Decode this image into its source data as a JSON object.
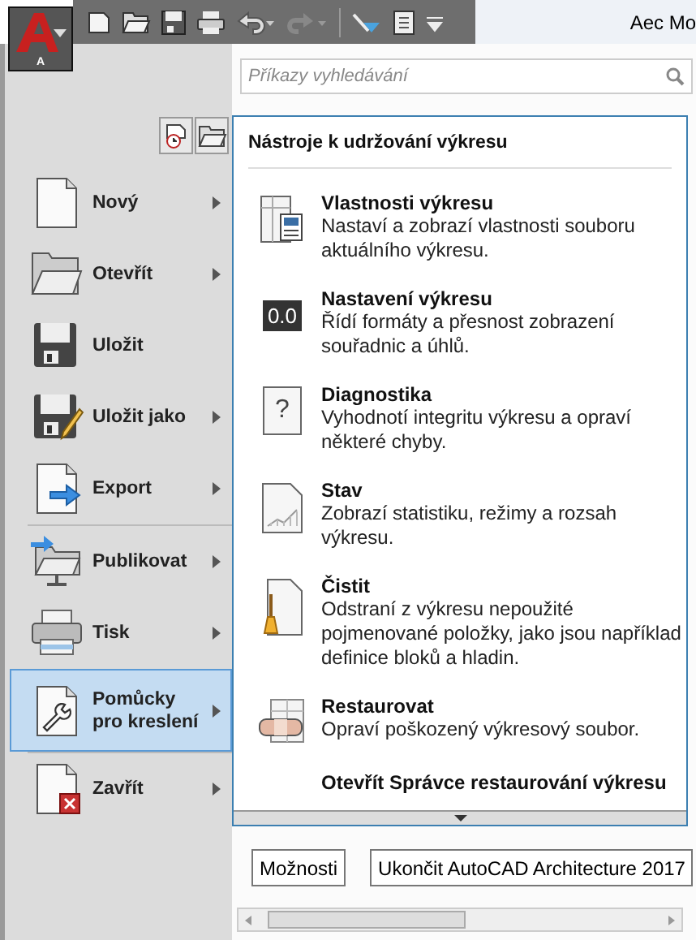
{
  "app_button": {
    "label": "A"
  },
  "title": "Aec Mo",
  "search": {
    "placeholder": "Příkazy vyhledávání"
  },
  "menu": [
    {
      "label": "Nový",
      "submenu": true,
      "selected": false,
      "divider_before": false
    },
    {
      "label": "Otevřít",
      "submenu": true,
      "selected": false,
      "divider_before": false
    },
    {
      "label": "Uložit",
      "submenu": false,
      "selected": false,
      "divider_before": false
    },
    {
      "label": "Uložit jako",
      "submenu": true,
      "selected": false,
      "divider_before": false
    },
    {
      "label": "Export",
      "submenu": true,
      "selected": false,
      "divider_before": false
    },
    {
      "label": "Publikovat",
      "submenu": true,
      "selected": false,
      "divider_before": true
    },
    {
      "label": "Tisk",
      "submenu": true,
      "selected": false,
      "divider_before": false
    },
    {
      "label": "Pomůcky pro kreslení",
      "submenu": true,
      "selected": true,
      "divider_before": false
    },
    {
      "label": "Zavřít",
      "submenu": true,
      "selected": false,
      "divider_before": true
    }
  ],
  "panel": {
    "title": "Nástroje k udržování výkresu",
    "items": [
      {
        "title": "Vlastnosti výkresu",
        "description": "Nastaví a zobrazí vlastnosti souboru aktuálního výkresu."
      },
      {
        "title": "Nastavení výkresu",
        "description": "Řídí formáty a přesnost zobrazení souřadnic a úhlů.",
        "icon_text": "0.0"
      },
      {
        "title": "Diagnostika",
        "description": "Vyhodnotí integritu výkresu a opraví některé chyby.",
        "icon_text": "?"
      },
      {
        "title": "Stav",
        "description": "Zobrazí statistiku, režimy a rozsah výkresu."
      },
      {
        "title": "Čistit",
        "description": "Odstraní z výkresu nepoužité pojmenované položky, jako jsou například definice bloků a hladin."
      },
      {
        "title": "Restaurovat",
        "description": "Opraví poškozený výkresový soubor."
      },
      {
        "title": "Otevřít Správce restaurování výkresu"
      }
    ]
  },
  "buttons": [
    "Možnosti",
    "Ukončit AutoCAD Architecture 2017"
  ]
}
